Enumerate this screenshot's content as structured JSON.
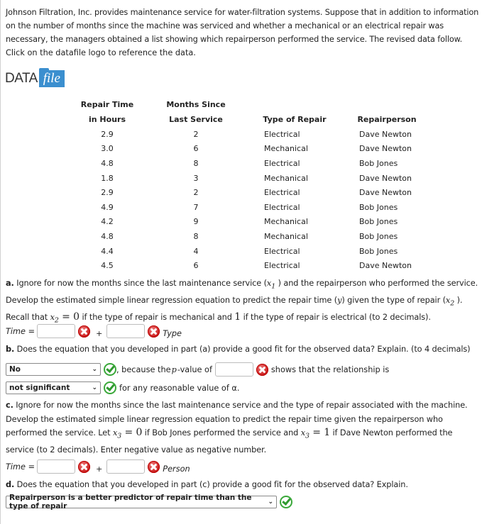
{
  "intro": {
    "text": "Johnson Filtration, Inc. provides maintenance service for water-filtration systems. Suppose that in addition to information on the number of months since the machine was serviced and whether a mechanical or an electrical repair was necessary, the managers obtained a list showing which repairperson performed the service. The revised data follow.",
    "click_note": "Click on the datafile logo to reference the data.",
    "logo": {
      "data_word": "DATA",
      "file_word": "file"
    }
  },
  "table": {
    "headers": [
      [
        "Repair Time",
        "in Hours"
      ],
      [
        "Months Since",
        "Last Service"
      ],
      [
        "",
        "Type of Repair"
      ],
      [
        "",
        "Repairperson"
      ]
    ],
    "rows": [
      [
        "2.9",
        "2",
        "Electrical",
        "Dave Newton"
      ],
      [
        "3.0",
        "6",
        "Mechanical",
        "Dave Newton"
      ],
      [
        "4.8",
        "8",
        "Electrical",
        "Bob Jones"
      ],
      [
        "1.8",
        "3",
        "Mechanical",
        "Dave Newton"
      ],
      [
        "2.9",
        "2",
        "Electrical",
        "Dave Newton"
      ],
      [
        "4.9",
        "7",
        "Electrical",
        "Bob Jones"
      ],
      [
        "4.2",
        "9",
        "Mechanical",
        "Bob Jones"
      ],
      [
        "4.8",
        "8",
        "Mechanical",
        "Bob Jones"
      ],
      [
        "4.4",
        "4",
        "Electrical",
        "Bob Jones"
      ],
      [
        "4.5",
        "6",
        "Electrical",
        "Dave Newton"
      ]
    ]
  },
  "part_a": {
    "label": "a.",
    "text_1": " Ignore for now the months since the last maintenance service (",
    "x1": "x",
    "x1_sub": "1",
    "text_2": " ) and the repairperson who performed the service. Develop the estimated simple linear regression equation to predict the repair time (",
    "y": "y",
    "text_3": ") given the type of repair (",
    "x2": "x",
    "x2_sub": "2",
    "text_4": " ). Recall that ",
    "text_5": " = ",
    "zero": "0",
    "text_6": " if the type of repair is mechanical and ",
    "one": "1",
    "text_7": " if the type of repair is electrical (to 2 decimals).",
    "eq_label": "Time =",
    "intercept_value": "",
    "plus": "+",
    "slope_value": "",
    "var_label": "Type",
    "intercept_status": "incorrect",
    "slope_status": "incorrect"
  },
  "part_b": {
    "label": "b.",
    "text": " Does the equation that you developed in part (a) provide a good fit for the observed data? Explain. (to 4 decimals)",
    "fit_select": "No",
    "fit_status": "correct",
    "because_text_1": ", because the ",
    "p": "p",
    "because_text_2": "-value of",
    "p_value": "",
    "p_status": "incorrect",
    "shows_text": "shows that the relationship is",
    "significance_select": "not significant",
    "significance_status": "correct",
    "alpha_text": "for any reasonable value of α."
  },
  "part_c": {
    "label": "c.",
    "text_1": " Ignore for now the months since the last maintenance service and the type of repair associated with the machine. Develop the estimated simple linear regression equation to predict the repair time given the repairperson who performed the service. Let ",
    "x3": "x",
    "x3_sub": "3",
    "eq": " = ",
    "zero": "0",
    "text_2": " if Bob Jones performed the service and ",
    "one": "1",
    "text_3": " if Dave Newton performed the service (to 2 decimals). Enter negative value as negative number.",
    "eq_label": "Time =",
    "intercept_value": "",
    "plus": "+",
    "slope_value": "",
    "var_label": "Person",
    "intercept_status": "incorrect",
    "slope_status": "incorrect"
  },
  "part_d": {
    "label": "d.",
    "text": " Does the equation that you developed in part (c) provide a good fit for the observed data? Explain.",
    "answer_select": "Repairperson is a better predictor of repair time than the type of repair",
    "answer_status": "correct"
  }
}
